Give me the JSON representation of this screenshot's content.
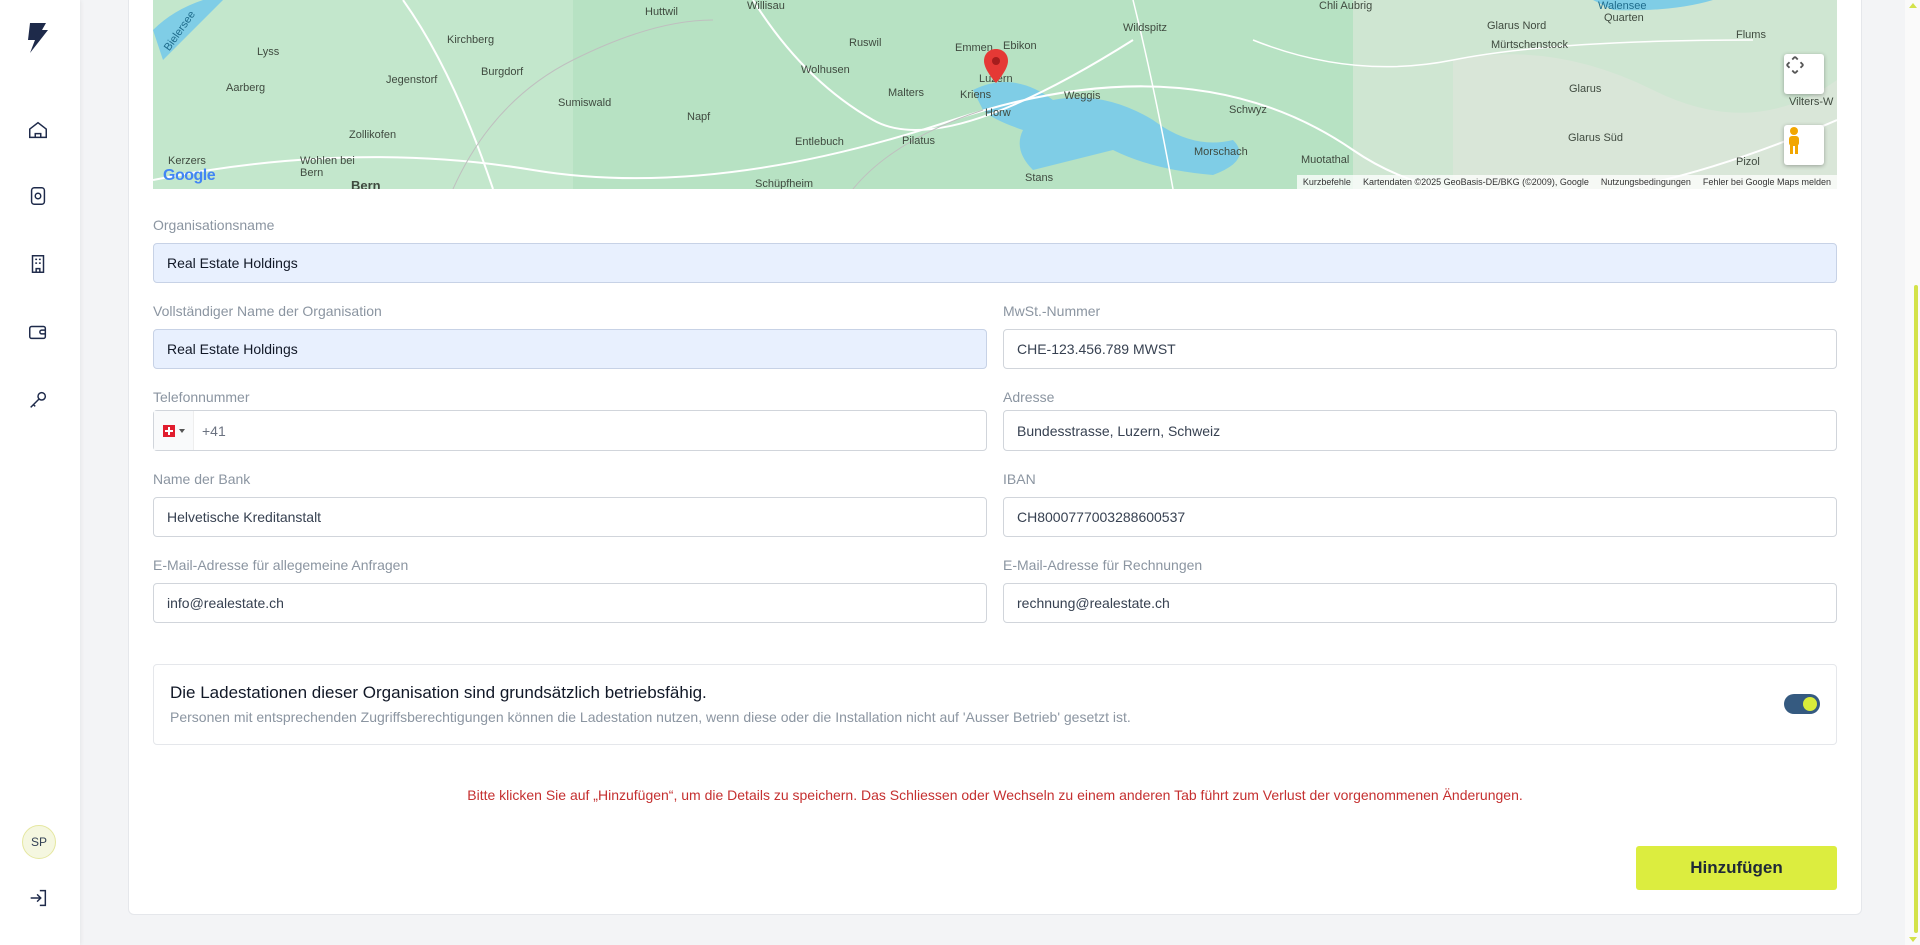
{
  "sidebar": {
    "avatar_initials": "SP"
  },
  "map": {
    "labels": [
      "Bielersee",
      "Lyss",
      "Kirchberg",
      "Huttwil",
      "Willisau",
      "Ruswil",
      "Emmen",
      "Ebikon",
      "Wildspitz",
      "Chli Aubrig",
      "Walensee",
      "Quarten",
      "Glarus Nord",
      "Mürtschenstock",
      "Flums",
      "Aarberg",
      "Jegenstorf",
      "Burgdorf",
      "Wolhusen",
      "Malters",
      "Kriens",
      "Luzern",
      "Weggis",
      "Glarus",
      "Vilters-W",
      "Sumiswald",
      "Napf",
      "Horw",
      "Schwyz",
      "Zollikofen",
      "Entlebuch",
      "Pilatus",
      "Morschach",
      "Glarus Süd",
      "Kerzers",
      "Wohlen bei Bern",
      "Bern",
      "Schüpfheim",
      "Stans",
      "Muotathal",
      "Pizol"
    ],
    "google": "Google",
    "attribution": [
      "Kurzbefehle",
      "Kartendaten ©2025 GeoBasis-DE/BKG (©2009), Google",
      "Nutzungsbedingungen",
      "Fehler bei Google Maps melden"
    ]
  },
  "form": {
    "org_name": {
      "label": "Organisationsname",
      "value": "Real Estate Holdings"
    },
    "full_name": {
      "label": "Vollständiger Name der Organisation",
      "value": "Real Estate Holdings"
    },
    "vat": {
      "label": "MwSt.-Nummer",
      "value": "CHE-123.456.789 MWST"
    },
    "phone": {
      "label": "Telefonnummer",
      "value": "+41"
    },
    "address": {
      "label": "Adresse",
      "value": "Bundesstrasse, Luzern, Schweiz"
    },
    "bank": {
      "label": "Name der Bank",
      "value": "Helvetische Kreditanstalt"
    },
    "iban": {
      "label": "IBAN",
      "value": "CH8000777003288600537"
    },
    "email_general": {
      "label": "E-Mail-Adresse für allegemeine Anfragen",
      "value": "info@realestate.ch"
    },
    "email_billing": {
      "label": "E-Mail-Adresse für Rechnungen",
      "value": "rechnung@realestate.ch"
    }
  },
  "status": {
    "title": "Die Ladestationen dieser Organisation sind grundsätzlich betriebsfähig.",
    "description": "Personen mit entsprechenden Zugriffsberechtigungen können die Ladestation nutzen, wenn diese oder die Installation nicht auf 'Ausser Betrieb' gesetzt ist.",
    "enabled": true
  },
  "warning": "Bitte klicken Sie auf „Hinzufügen“, um die Details zu speichern. Das Schliessen oder Wechseln zu einem anderen Tab führt zum Verlust der vorgenommenen Änderungen.",
  "actions": {
    "add_label": "Hinzufügen"
  },
  "colors": {
    "accent": "#dced3f",
    "primary": "#1e3a5f",
    "warning": "#c53030",
    "filled_field": "#e8f0fe"
  }
}
